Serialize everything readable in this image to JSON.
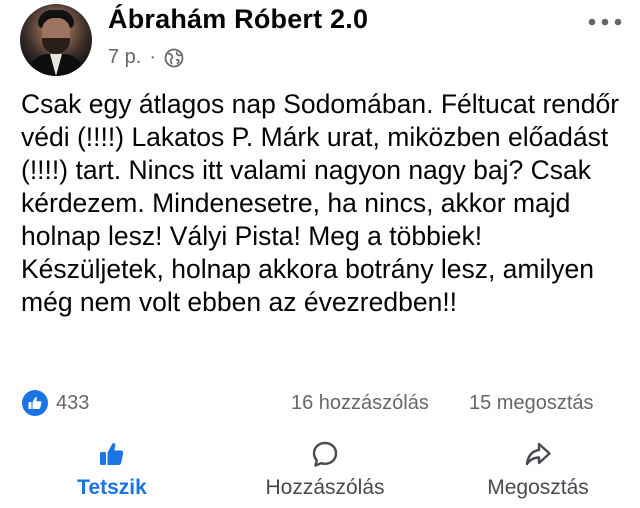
{
  "post": {
    "author": "Ábrahám Róbert 2.0",
    "time": "7 p.",
    "separator": "·",
    "privacy_icon": "globe-icon",
    "more_icon": "more-dots-icon",
    "text": "Csak egy átlagos nap Sodomában. Féltucat rendőr védi (!!!!) Lakatos P. Márk urat, miközben előadást (!!!!) tart. Nincs itt valami nagyon nagy baj? Csak kérdezem. Mindenesetre, ha nincs, akkor majd holnap lesz! Vályi Pista! Meg a többiek! Készüljetek, holnap akkora botrány lesz, amilyen még nem volt ebben az évezredben!!"
  },
  "stats": {
    "reaction_icon": "like-icon",
    "reaction_count": "433",
    "comments": "16 hozzászólás",
    "shares": "15 megosztás"
  },
  "actions": {
    "like": "Tetszik",
    "comment": "Hozzászólás",
    "share": "Megosztás"
  },
  "colors": {
    "accent": "#1b74e4",
    "secondary_text": "#65676b",
    "text": "#050505"
  }
}
